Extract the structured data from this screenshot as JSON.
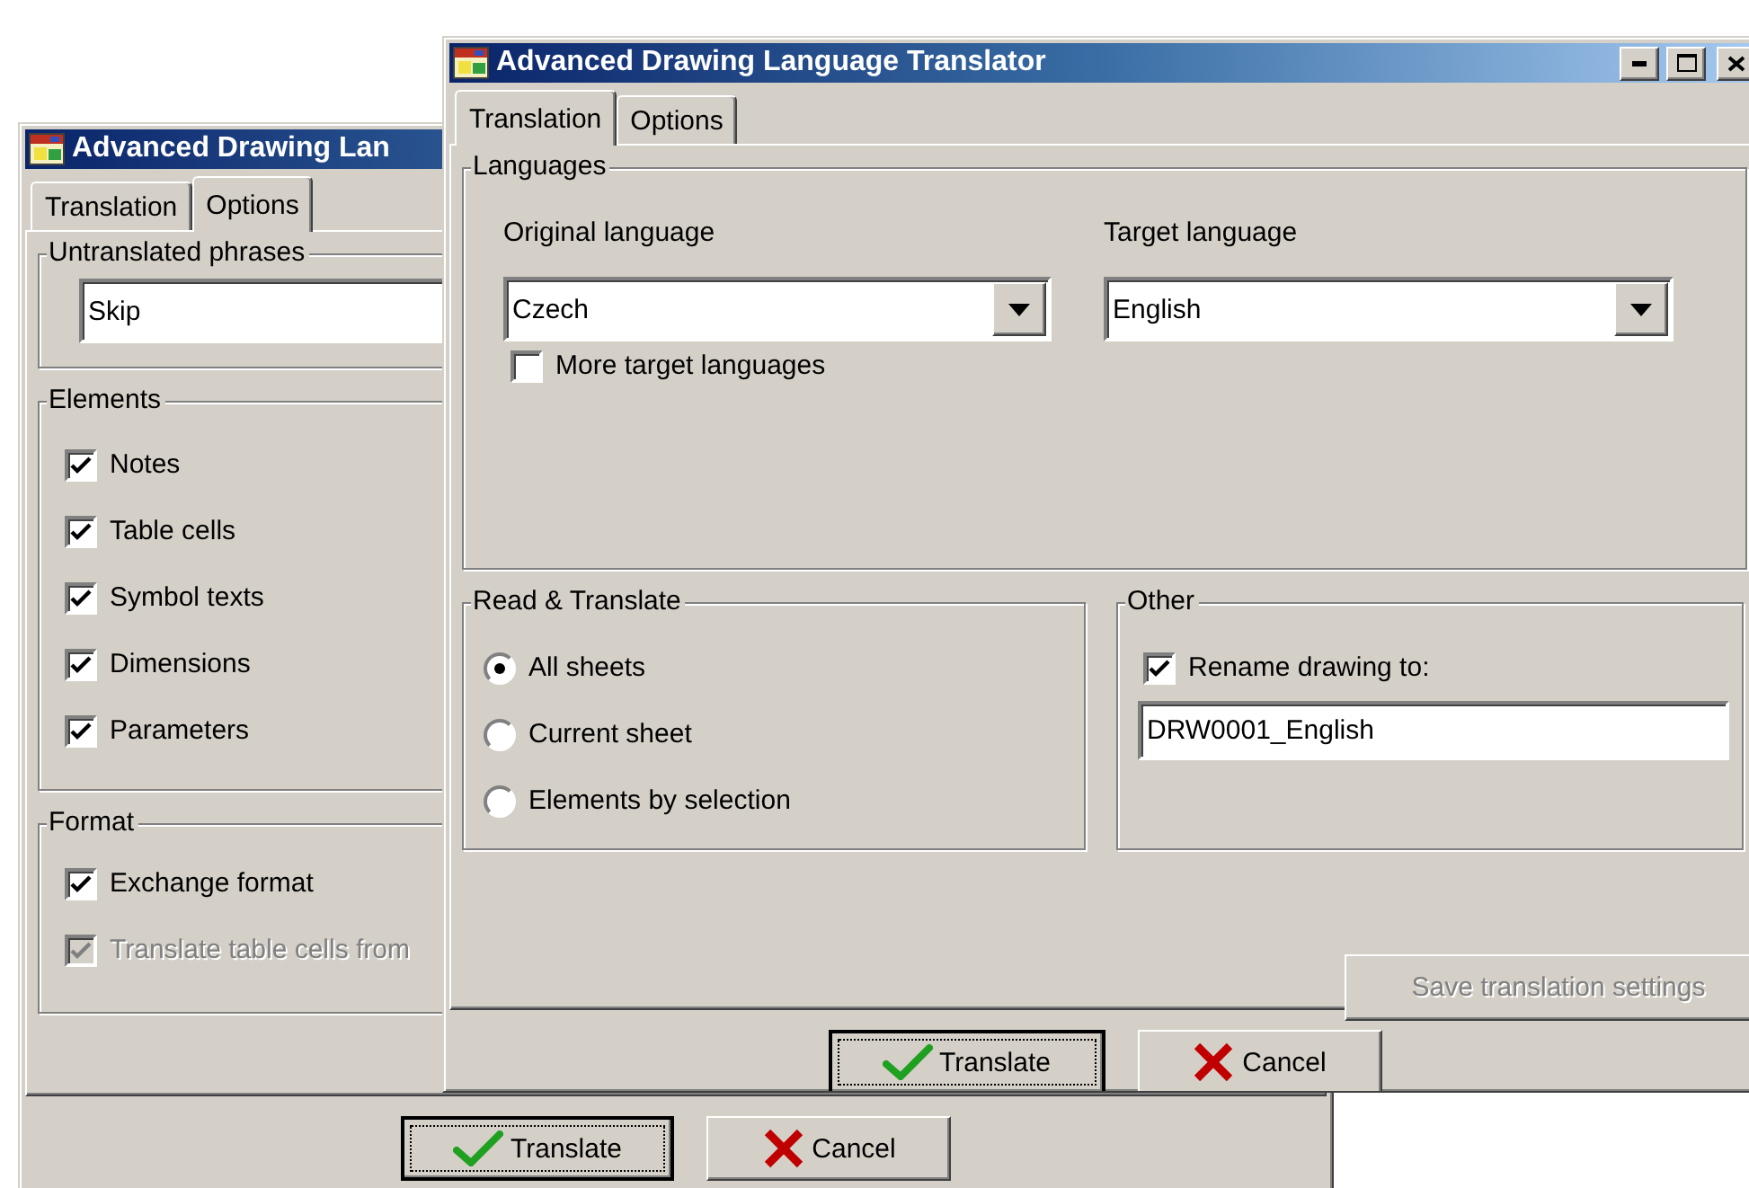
{
  "back_window": {
    "title": "Advanced Drawing Lan",
    "tabs": [
      {
        "label": "Translation",
        "selected": false
      },
      {
        "label": "Options",
        "selected": true
      }
    ],
    "untranslated_phrases": {
      "label": "Untranslated phrases",
      "value": "Skip"
    },
    "elements": {
      "label": "Elements",
      "items": [
        {
          "label": "Notes",
          "checked": true
        },
        {
          "label": "Table cells",
          "checked": true
        },
        {
          "label": "Symbol texts",
          "checked": true
        },
        {
          "label": "Dimensions",
          "checked": true
        },
        {
          "label": "Parameters",
          "checked": true
        }
      ]
    },
    "format": {
      "label": "Format",
      "items": [
        {
          "label": "Exchange format",
          "checked": true,
          "disabled": false
        },
        {
          "label": "Translate table cells from",
          "checked": true,
          "disabled": true
        }
      ]
    },
    "buttons": [
      {
        "label": "Translate",
        "kind": "ok",
        "default": true
      },
      {
        "label": "Cancel",
        "kind": "cancel",
        "default": false
      }
    ]
  },
  "front_window": {
    "title": "Advanced Drawing Language Translator",
    "tabs": [
      {
        "label": "Translation",
        "selected": true
      },
      {
        "label": "Options",
        "selected": false
      }
    ],
    "languages": {
      "label": "Languages",
      "original": {
        "label": "Original language",
        "value": "Czech"
      },
      "target": {
        "label": "Target language",
        "value": "English"
      },
      "more": {
        "label": "More target languages",
        "checked": false
      }
    },
    "read_translate": {
      "label": "Read & Translate",
      "options": [
        {
          "label": "All sheets",
          "selected": true
        },
        {
          "label": "Current sheet",
          "selected": false
        },
        {
          "label": "Elements by selection",
          "selected": false
        }
      ]
    },
    "other": {
      "label": "Other",
      "rename": {
        "label": "Rename drawing to:",
        "checked": true
      },
      "value": "DRW0001_English"
    },
    "save_button": {
      "label": "Save translation settings",
      "disabled": true
    },
    "buttons": [
      {
        "label": "Translate",
        "kind": "ok",
        "default": true
      },
      {
        "label": "Cancel",
        "kind": "cancel",
        "default": false
      }
    ]
  }
}
